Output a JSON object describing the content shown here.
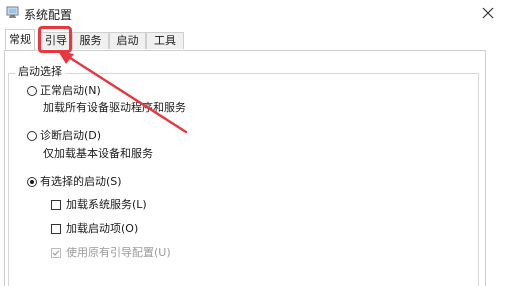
{
  "window": {
    "title": "系统配置",
    "icon": "msconfig-icon",
    "close_icon": "close-icon"
  },
  "tabs": [
    {
      "label": "常规",
      "active": true
    },
    {
      "label": "引导",
      "active": false
    },
    {
      "label": "服务",
      "active": false
    },
    {
      "label": "启动",
      "active": false
    },
    {
      "label": "工具",
      "active": false
    }
  ],
  "startup_selection": {
    "legend": "启动选择",
    "normal": {
      "label": "正常启动(N)",
      "description": "加载所有设备驱动程序和服务",
      "selected": false
    },
    "diagnostic": {
      "label": "诊断启动(D)",
      "description": "仅加载基本设备和服务",
      "selected": false
    },
    "selective": {
      "label": "有选择的启动(S)",
      "selected": true,
      "options": [
        {
          "label": "加载系统服务(L)",
          "checked": false,
          "enabled": true
        },
        {
          "label": "加载启动项(O)",
          "checked": false,
          "enabled": true
        },
        {
          "label": "使用原有引导配置(U)",
          "checked": true,
          "enabled": false
        }
      ]
    }
  },
  "annotation": {
    "color": "#e8373e",
    "highlight_target": "引导"
  }
}
